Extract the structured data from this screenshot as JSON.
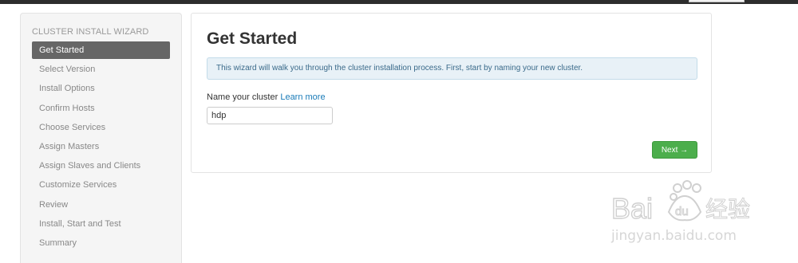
{
  "sidebar": {
    "header": "CLUSTER INSTALL WIZARD",
    "items": [
      {
        "label": "Get Started"
      },
      {
        "label": "Select Version"
      },
      {
        "label": "Install Options"
      },
      {
        "label": "Confirm Hosts"
      },
      {
        "label": "Choose Services"
      },
      {
        "label": "Assign Masters"
      },
      {
        "label": "Assign Slaves and Clients"
      },
      {
        "label": "Customize Services"
      },
      {
        "label": "Review"
      },
      {
        "label": "Install, Start and Test"
      },
      {
        "label": "Summary"
      }
    ]
  },
  "main": {
    "title": "Get Started",
    "info_text": "This wizard will walk you through the cluster installation process. First, start by naming your new cluster.",
    "name_label": "Name your cluster",
    "learn_more": "Learn more",
    "cluster_name_value": "hdp",
    "next_label": "Next →"
  },
  "watermark": {
    "text": "Bai du 经验",
    "url": "jingyan.baidu.com"
  }
}
